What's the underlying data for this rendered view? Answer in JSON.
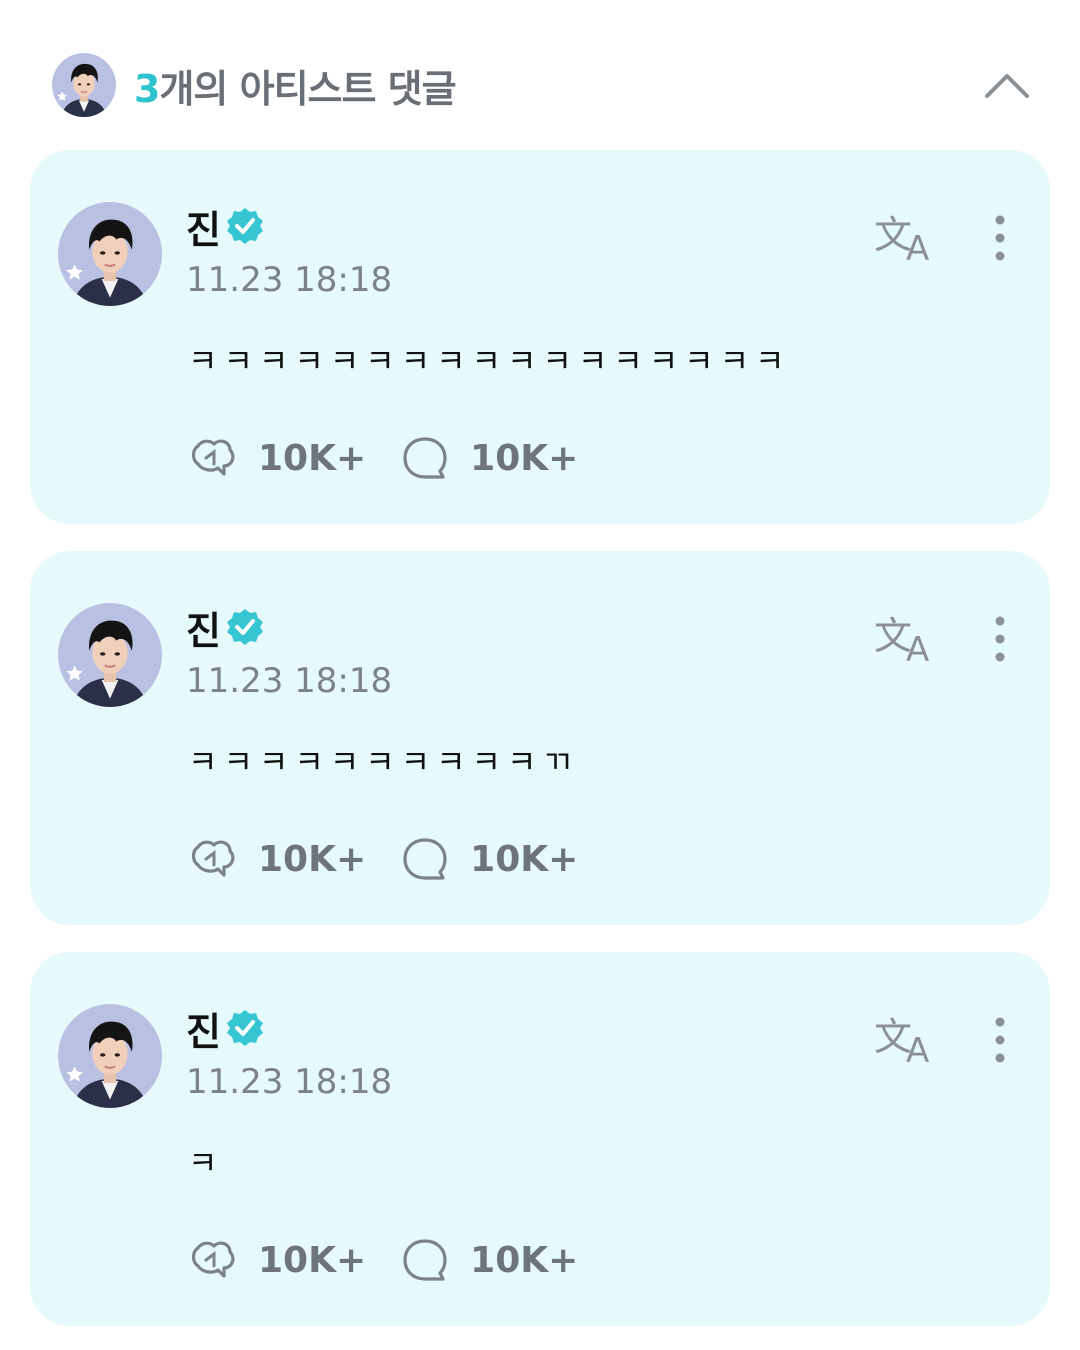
{
  "header": {
    "count": "3",
    "title_rest": "개의 아티스트 댓글"
  },
  "colors": {
    "accent": "#2ec3cf",
    "card_bg": "#e6f9fb",
    "muted": "#7b8288"
  },
  "comments": [
    {
      "author": "진",
      "time": "11.23 18:18",
      "text": "ㅋㅋㅋㅋㅋㅋㅋㅋㅋㅋㅋㅋㅋㅋㅋㅋㅋ",
      "likes": "10K+",
      "replies": "10K+"
    },
    {
      "author": "진",
      "time": "11.23 18:18",
      "text": "ㅋㅋㅋㅋㅋㅋㅋㅋㅋㅋㄲ",
      "likes": "10K+",
      "replies": "10K+"
    },
    {
      "author": "진",
      "time": "11.23 18:18",
      "text": "ㅋ",
      "likes": "10K+",
      "replies": "10K+"
    }
  ],
  "icons": {
    "collapse": "chevron-up-icon",
    "verified": "verified-badge-icon",
    "translate": "translate-icon",
    "more": "more-vertical-icon",
    "like": "cheer-icon",
    "reply": "comment-bubble-icon"
  }
}
